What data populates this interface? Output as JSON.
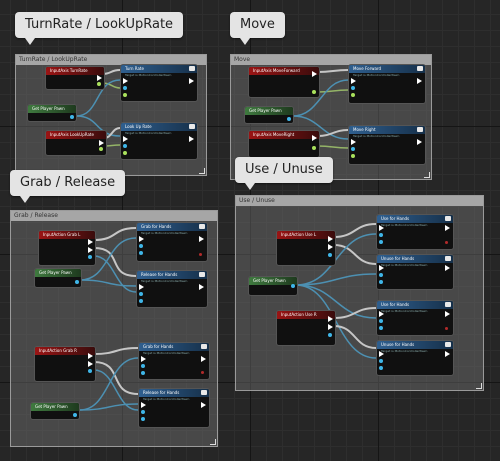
{
  "bubbles": {
    "turnrate": "TurnRate / LookUpRate",
    "move": "Move",
    "grab": "Grab / Release",
    "use": "Use / Unuse"
  },
  "comments": {
    "turnrate": "TurnRate / LookUpRate",
    "move": "Move",
    "grab": "Grab / Release",
    "use": "Use / Unuse"
  },
  "nodes": {
    "turn_event": "InputAxis TurnRate",
    "turn_player": "Get Player Pawn",
    "turn_lookup_event": "InputAxis LookUpRate",
    "turn_call1": "Turn Rate",
    "turn_call2": "Look Up Rate",
    "move_event1": "InputAxis MoveForward",
    "move_player": "Get Player Pawn",
    "move_event2": "InputAxis MoveRight",
    "move_call1": "Move Forward",
    "move_call2": "Move Right",
    "grab_event1": "InputAction Grab L",
    "grab_player1": "Get Player Pawn",
    "grab_event2": "InputAction Grab R",
    "grab_player2": "Get Player Pawn",
    "grab_call1": "Grab for Hands",
    "grab_call2": "Release for Hands",
    "grab_call3": "Grab for Hands",
    "grab_call4": "Release for Hands",
    "use_event1": "InputAction Use L",
    "use_player": "Get Player Pawn",
    "use_event2": "InputAction Use R",
    "use_call1": "Use for Hands",
    "use_call2": "Unuse for Hands",
    "use_call3": "Use for Hands",
    "use_call4": "Unuse for Hands"
  },
  "subtitle": "Target is MotionControllerPawn",
  "colors": {
    "exec_wire": "#ffffff",
    "object_wire": "#2ea2dc",
    "float_wire": "#a9e15c",
    "event_header": "#9a1414",
    "pure_header": "#3f7a3f",
    "call_header": "#2f5f8f"
  }
}
